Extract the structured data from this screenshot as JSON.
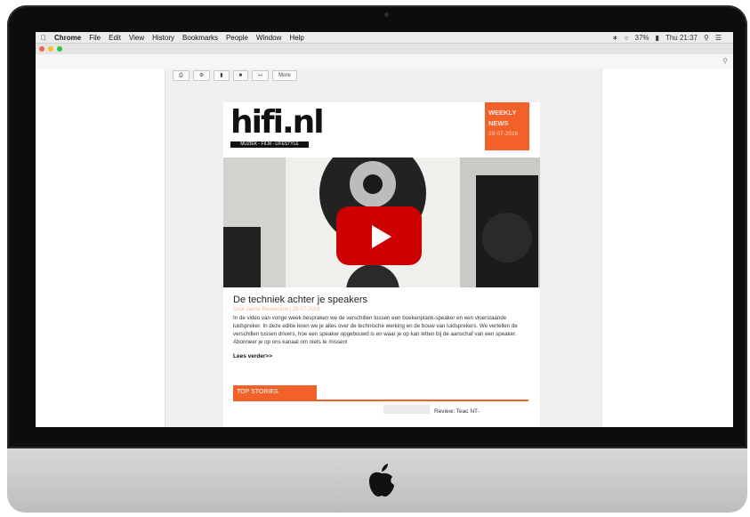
{
  "menubar": {
    "apple_icon": "apple-icon",
    "items": [
      "Chrome",
      "File",
      "Edit",
      "View",
      "History",
      "Bookmarks",
      "People",
      "Window",
      "Help"
    ],
    "battery": "37%",
    "clock": "Thu 21:37"
  },
  "toolbar": {
    "more_label": "More"
  },
  "email": {
    "logo_text": "hifi.nl",
    "logo_tagline": "MUZIEK - FILM - LIFESTYLE",
    "weekly_line1": "WEEKLY",
    "weekly_line2": "NEWS",
    "weekly_date": "29-07-2016",
    "article_title": "De techniek achter je speakers",
    "article_meta": "Door Jamie Biesemans | 28-07-2016",
    "article_body": "In de video van vorige week bespraken we de verschillen tussen een boekenplank-speaker en een vloerstaande luidspreker. In deze editie leren we je alles over de technische werking en de bouw van luidsprekers. We vertellen de verschillen tussen drivers, hoe een speaker opgebouwd is en waar je op kan letten bij de aanschaf van een speaker. Abonneer je op ons kanaal om niets te missen!",
    "read_more": "Lees verder>>",
    "top_stories": "TOP STORIES",
    "review_snippet": "Review: Teac NT-"
  },
  "colors": {
    "accent": "#f2612a",
    "youtube_red": "#cc0000"
  }
}
